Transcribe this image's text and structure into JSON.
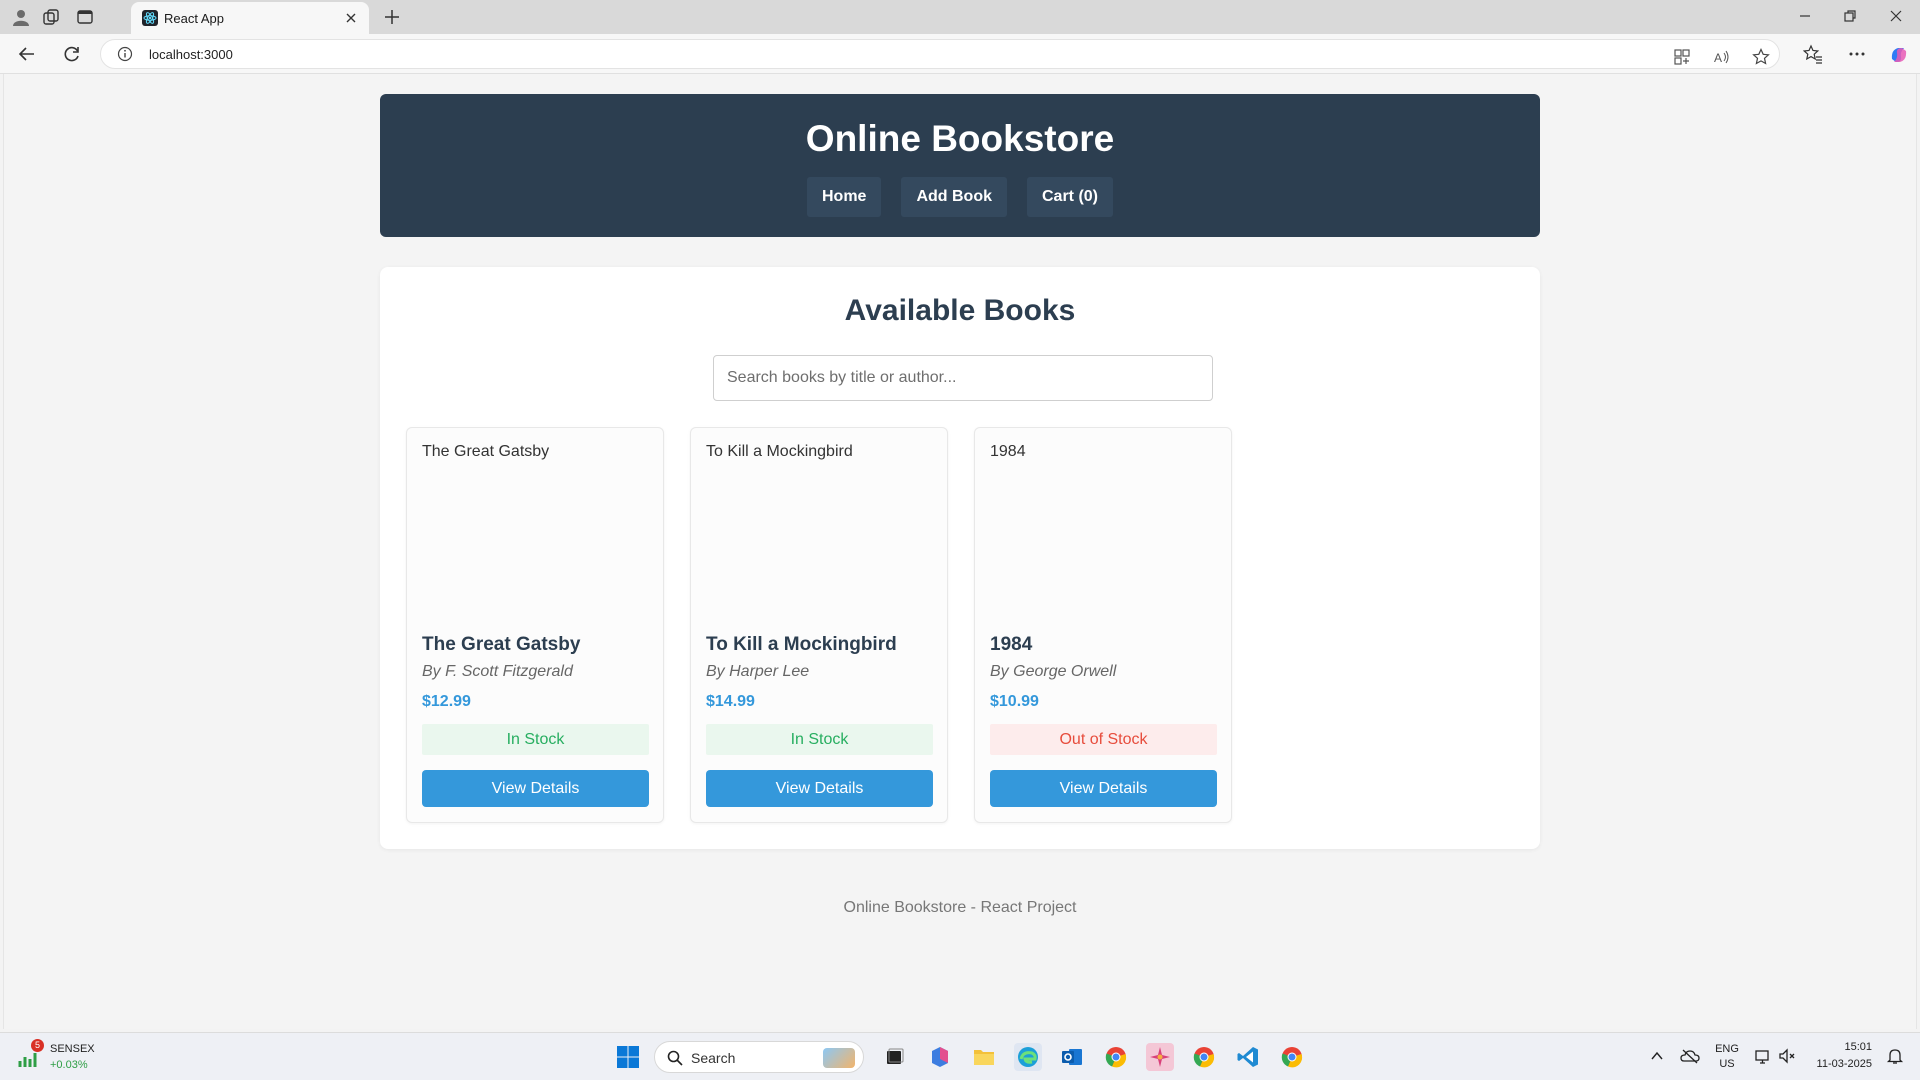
{
  "browser": {
    "tab_title": "React App",
    "url": "localhost:3000"
  },
  "site": {
    "title": "Online Bookstore",
    "nav": [
      {
        "label": "Home"
      },
      {
        "label": "Add Book"
      },
      {
        "label": "Cart (0)"
      }
    ]
  },
  "catalog": {
    "heading": "Available Books",
    "search_placeholder": "Search books by title or author...",
    "books": [
      {
        "cover_alt": "The Great Gatsby",
        "title": "The Great Gatsby",
        "author": "By F. Scott Fitzgerald",
        "price": "$12.99",
        "stock": "In Stock",
        "in_stock": true,
        "button": "View Details"
      },
      {
        "cover_alt": "To Kill a Mockingbird",
        "title": "To Kill a Mockingbird",
        "author": "By Harper Lee",
        "price": "$14.99",
        "stock": "In Stock",
        "in_stock": true,
        "button": "View Details"
      },
      {
        "cover_alt": "1984",
        "title": "1984",
        "author": "By George Orwell",
        "price": "$10.99",
        "stock": "Out of Stock",
        "in_stock": false,
        "button": "View Details"
      }
    ]
  },
  "footer": {
    "text": "Online Bookstore - React Project"
  },
  "taskbar": {
    "widget_badge": "5",
    "widget_name": "SENSEX",
    "widget_change": "+0.03%",
    "search_label": "Search",
    "lang_top": "ENG",
    "lang_bottom": "US",
    "time": "15:01",
    "date": "11-03-2025"
  },
  "colors": {
    "header_bg": "#2c3e50",
    "accent": "#3498db",
    "in_stock": "#27ae60",
    "out_of_stock": "#e74c3c"
  },
  "icons": [
    "profile-icon",
    "workspaces-icon",
    "tab-actions-icon",
    "react-favicon-icon",
    "close-icon",
    "plus-icon",
    "minimize-icon",
    "restore-icon",
    "back-icon",
    "refresh-icon",
    "info-icon",
    "app-available-icon",
    "read-aloud-icon",
    "favorite-star-icon",
    "favorites-icon",
    "more-icon",
    "copilot-icon",
    "windows-start-icon",
    "search-icon"
  ]
}
